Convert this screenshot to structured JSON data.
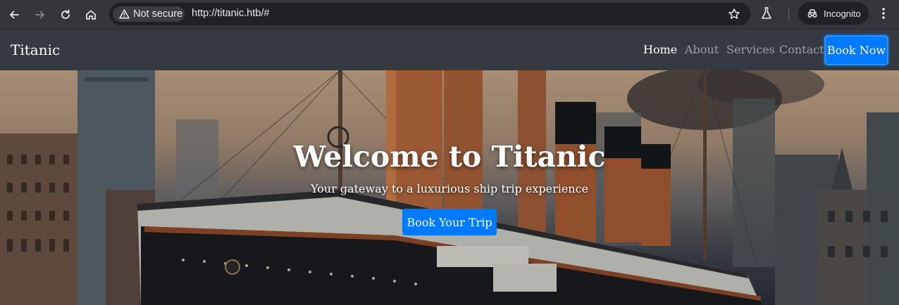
{
  "browser": {
    "security_label": "Not secure",
    "url": "http://titanic.htb/#",
    "incognito_label": "Incognito",
    "icons": [
      "back-icon",
      "forward-icon",
      "reload-icon",
      "home-icon",
      "warning-icon",
      "star-icon",
      "labs-icon",
      "incognito-icon",
      "menu-icon"
    ]
  },
  "navbar": {
    "brand": "Titanic",
    "links": [
      {
        "label": "Home",
        "active": true
      },
      {
        "label": "About",
        "active": false
      },
      {
        "label": "Services",
        "active": false
      },
      {
        "label": "Contact",
        "active": false
      }
    ],
    "cta_label": "Book Now"
  },
  "hero": {
    "title": "Welcome to Titanic",
    "subtitle": "Your gateway to a luxurious ship trip experience",
    "button_label": "Book Your Trip"
  },
  "colors": {
    "navbar_bg": "#343a40",
    "primary": "#007bff",
    "chrome_bg": "#35363a"
  }
}
